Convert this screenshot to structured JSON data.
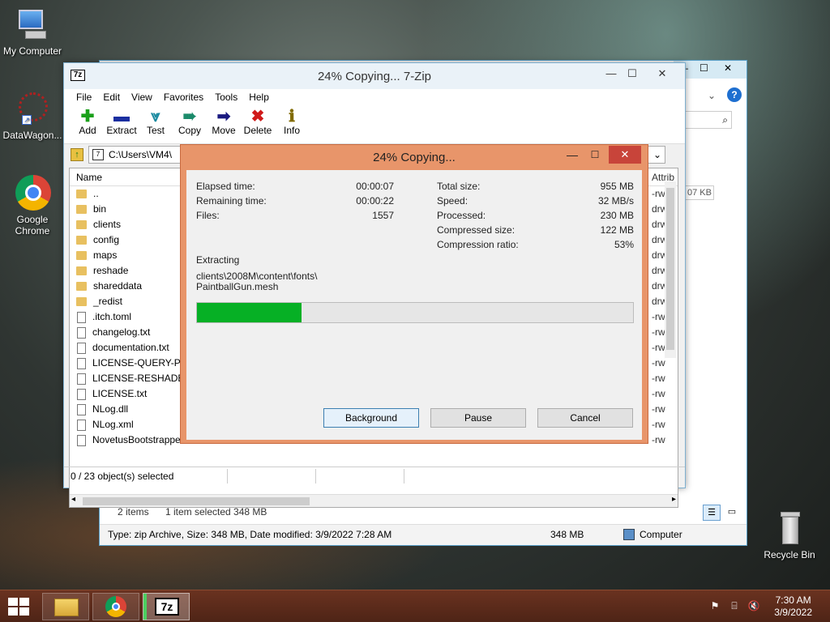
{
  "desktop": {
    "icons": [
      {
        "label": "My Computer"
      },
      {
        "label": "DataWagon..."
      },
      {
        "label": "Google Chrome"
      },
      {
        "label": "Recycle Bin"
      }
    ]
  },
  "explorer": {
    "status_items": "2 items",
    "status_selected": "1 item selected  348 MB",
    "details": "Type: zip Archive, Size: 348 MB, Date modified: 3/9/2022 7:28 AM",
    "size": "348 MB",
    "location": "Computer",
    "partial_size": "07 KB"
  },
  "window": {
    "title": "24% Copying... 7-Zip",
    "menu": [
      "File",
      "Edit",
      "View",
      "Favorites",
      "Tools",
      "Help"
    ],
    "toolbar": [
      {
        "label": "Add",
        "icon": "add-icon"
      },
      {
        "label": "Extract",
        "icon": "extract-icon"
      },
      {
        "label": "Test",
        "icon": "test-icon"
      },
      {
        "label": "Copy",
        "icon": "copy-icon"
      },
      {
        "label": "Move",
        "icon": "move-icon"
      },
      {
        "label": "Delete",
        "icon": "delete-icon"
      },
      {
        "label": "Info",
        "icon": "info-icon"
      }
    ],
    "path": "C:\\Users\\VM4\\",
    "column_name": "Name",
    "column_attr": "Attrib",
    "files": [
      {
        "name": "..",
        "type": "folder",
        "attr": "-rw"
      },
      {
        "name": "bin",
        "type": "folder",
        "attr": "drw"
      },
      {
        "name": "clients",
        "type": "folder",
        "attr": "drw"
      },
      {
        "name": "config",
        "type": "folder",
        "attr": "drw"
      },
      {
        "name": "maps",
        "type": "folder",
        "attr": "drw"
      },
      {
        "name": "reshade",
        "type": "folder",
        "attr": "drw"
      },
      {
        "name": "shareddata",
        "type": "folder",
        "attr": "drw"
      },
      {
        "name": "_redist",
        "type": "folder",
        "attr": "drw"
      },
      {
        "name": ".itch.toml",
        "type": "file",
        "attr": "-rw"
      },
      {
        "name": "changelog.txt",
        "type": "file",
        "attr": "-rw"
      },
      {
        "name": "documentation.txt",
        "type": "file",
        "attr": "-rw"
      },
      {
        "name": "LICENSE-QUERY-PHP",
        "type": "file",
        "attr": "-rw"
      },
      {
        "name": "LICENSE-RESHADE.txt",
        "type": "file",
        "attr": "-rw"
      },
      {
        "name": "LICENSE.txt",
        "type": "file",
        "attr": "-rw"
      },
      {
        "name": "NLog.dll",
        "type": "file",
        "attr": "-rw"
      },
      {
        "name": "NLog.xml",
        "type": "file",
        "attr": "-rw"
      },
      {
        "name": "NovetusBootstrapper",
        "type": "file",
        "attr": "-rw"
      }
    ],
    "status": "0 / 23 object(s) selected"
  },
  "dialog": {
    "title": "24% Copying...",
    "elapsed_label": "Elapsed time:",
    "elapsed": "00:00:07",
    "remaining_label": "Remaining time:",
    "remaining": "00:00:22",
    "files_label": "Files:",
    "files": "1557",
    "total_label": "Total size:",
    "total": "955 MB",
    "speed_label": "Speed:",
    "speed": "32 MB/s",
    "processed_label": "Processed:",
    "processed": "230 MB",
    "compressed_label": "Compressed size:",
    "compressed": "122 MB",
    "ratio_label": "Compression ratio:",
    "ratio": "53%",
    "action": "Extracting",
    "current_path": "clients\\2008M\\content\\fonts\\",
    "current_file": "PaintballGun.mesh",
    "progress_fraction": 0.24,
    "buttons": {
      "background": "Background",
      "pause": "Pause",
      "cancel": "Cancel"
    }
  },
  "taskbar": {
    "time": "7:30 AM",
    "date": "3/9/2022",
    "apps": [
      {
        "name": "file-explorer"
      },
      {
        "name": "chrome"
      },
      {
        "name": "7-zip"
      }
    ]
  }
}
